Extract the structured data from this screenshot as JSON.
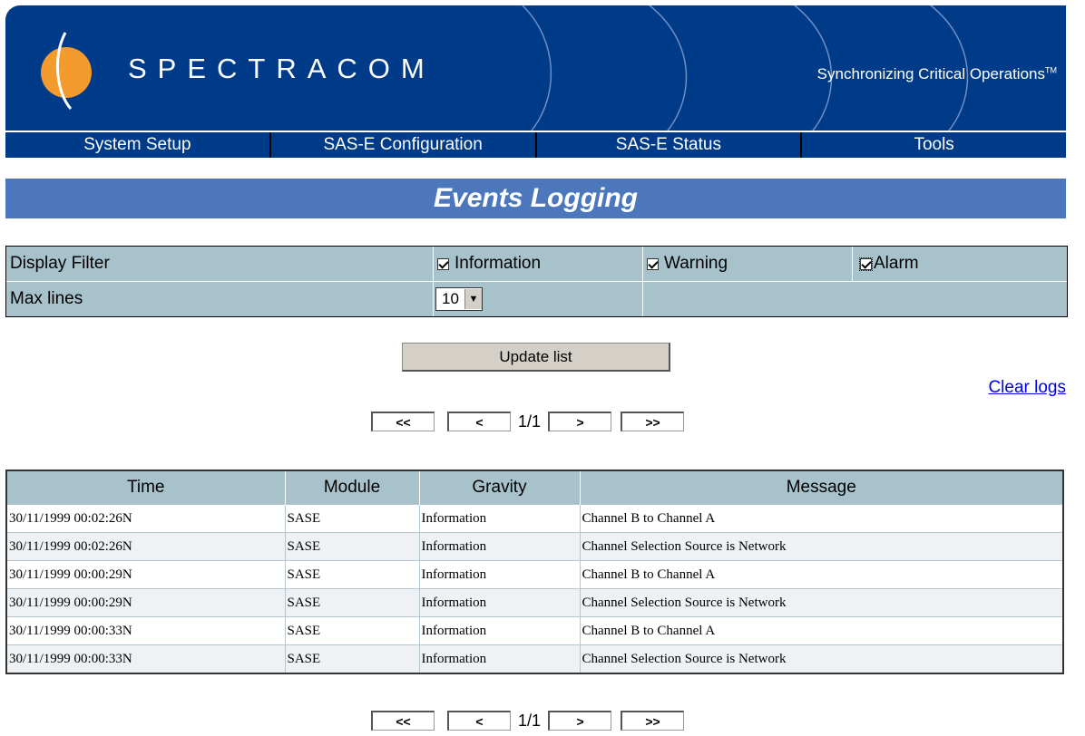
{
  "brand": {
    "name": "SPECTRACOM",
    "tagline": "Synchronizing Critical Operations",
    "tm": "TM"
  },
  "nav": [
    "System Setup",
    "SAS-E Configuration",
    "SAS-E Status",
    "Tools"
  ],
  "page_title": "Events Logging",
  "filter": {
    "display_filter_label": "Display Filter",
    "options": [
      {
        "label": "Information",
        "checked": true
      },
      {
        "label": "Warning",
        "checked": true
      },
      {
        "label": "Alarm",
        "checked": true
      }
    ],
    "max_lines_label": "Max lines",
    "max_lines_value": "10"
  },
  "update_button": "Update list",
  "clear_logs": "Clear logs",
  "pager": {
    "first": "<<",
    "prev": "<",
    "page": "1/1",
    "next": ">",
    "last": ">>"
  },
  "table": {
    "headers": [
      "Time",
      "Module",
      "Gravity",
      "Message"
    ],
    "rows": [
      [
        "30/11/1999 00:02:26N",
        "SASE",
        "Information",
        "Channel B to Channel A"
      ],
      [
        "30/11/1999 00:02:26N",
        "SASE",
        "Information",
        "Channel Selection Source is Network"
      ],
      [
        "30/11/1999 00:00:29N",
        "SASE",
        "Information",
        "Channel B to Channel A"
      ],
      [
        "30/11/1999 00:00:29N",
        "SASE",
        "Information",
        "Channel Selection Source is Network"
      ],
      [
        "30/11/1999 00:00:33N",
        "SASE",
        "Information",
        "Channel B to Channel A"
      ],
      [
        "30/11/1999 00:00:33N",
        "SASE",
        "Information",
        "Channel Selection Source is Network"
      ]
    ]
  },
  "colors": {
    "brand_blue": "#003b8a",
    "logo_orange": "#f39b2c",
    "title_bar": "#4d77bd",
    "table_header": "#a7c2cb"
  }
}
